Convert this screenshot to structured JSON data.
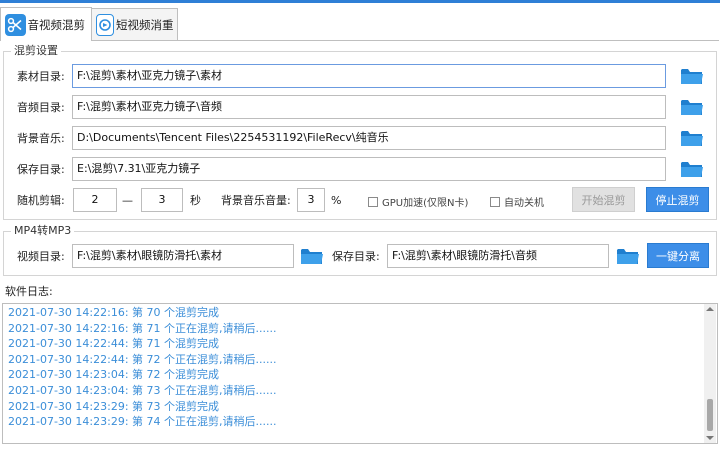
{
  "tabs": [
    {
      "label": "音视频混剪",
      "icon": "scissors-icon",
      "active": true
    },
    {
      "label": "短视频消重",
      "icon": "dedupe-icon",
      "active": false
    }
  ],
  "mix_settings": {
    "title": "混剪设置",
    "material_dir": {
      "label": "素材目录:",
      "value": "F:\\混剪\\素材\\亚克力镜子\\素材"
    },
    "audio_dir": {
      "label": "音频目录:",
      "value": "F:\\混剪\\素材\\亚克力镜子\\音频"
    },
    "bg_music": {
      "label": "背景音乐:",
      "value": "D:\\Documents\\Tencent Files\\2254531192\\FileRecv\\纯音乐"
    },
    "save_dir": {
      "label": "保存目录:",
      "value": "E:\\混剪\\7.31\\亚克力镜子"
    },
    "random_cut": {
      "label": "随机剪辑:",
      "min": "2",
      "sep": "—",
      "max": "3",
      "unit": "秒"
    },
    "bg_volume": {
      "label": "背景音乐音量:",
      "value": "3",
      "unit": "%"
    },
    "gpu_accel": {
      "label": "GPU加速(仅限N卡)",
      "checked": false
    },
    "auto_shutdown": {
      "label": "自动关机",
      "checked": false
    },
    "start_button": "开始混剪",
    "stop_button": "停止混剪"
  },
  "mp4_to_mp3": {
    "title": "MP4转MP3",
    "video_dir": {
      "label": "视频目录:",
      "value": "F:\\混剪\\素材\\眼镜防滑托\\素材"
    },
    "save_dir": {
      "label": "保存目录:",
      "value": "F:\\混剪\\素材\\眼镜防滑托\\音频"
    },
    "split_button": "一键分离"
  },
  "log": {
    "title": "软件日志:",
    "lines": [
      "2021-07-30 14:22:16:   第 70 个混剪完成",
      "2021-07-30 14:22:16:   第 71 个正在混剪,请稍后......",
      "2021-07-30 14:22:44:   第 71 个混剪完成",
      "2021-07-30 14:22:44:   第 72 个正在混剪,请稍后......",
      "2021-07-30 14:23:04:   第 72 个混剪完成",
      "2021-07-30 14:23:04:   第 73 个正在混剪,请稍后......",
      "2021-07-30 14:23:29:   第 73 个混剪完成",
      "2021-07-30 14:23:29:   第 74 个正在混剪,请稍后......"
    ]
  },
  "colors": {
    "accent": "#3d8ee8",
    "folder": "#2a8ad4",
    "log_text": "#3b8ed8"
  }
}
